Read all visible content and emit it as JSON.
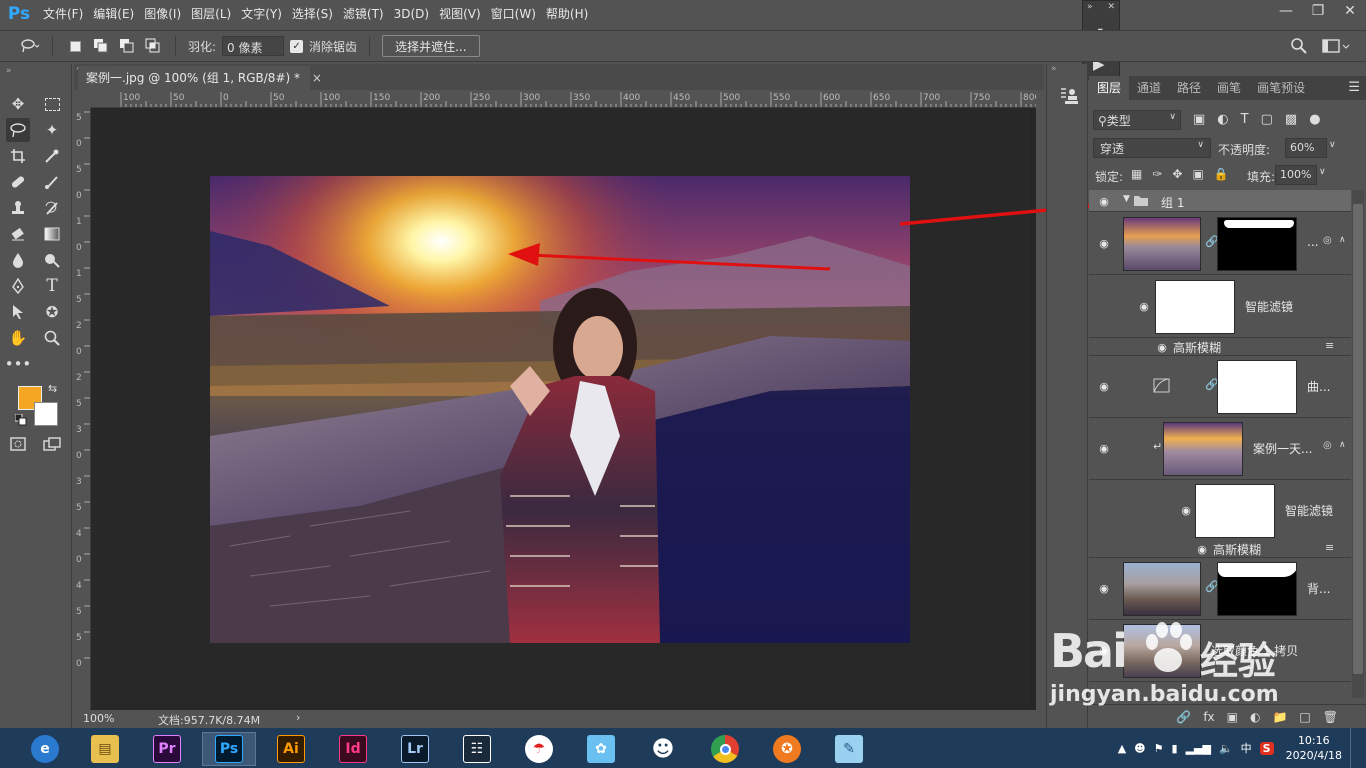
{
  "app": {
    "logo": "Ps",
    "menus": [
      "文件(F)",
      "编辑(E)",
      "图像(I)",
      "图层(L)",
      "文字(Y)",
      "选择(S)",
      "滤镜(T)",
      "3D(D)",
      "视图(V)",
      "窗口(W)",
      "帮助(H)"
    ],
    "window_controls": [
      "minimize-icon",
      "restore-icon",
      "close-icon"
    ]
  },
  "options": {
    "feather_label": "羽化:",
    "feather_value": "0 像素",
    "antialias_label": "消除锯齿",
    "antialias_checked": true,
    "select_mask_button": "选择并遮住...",
    "right_icons": [
      "search-icon",
      "workspace-icon"
    ]
  },
  "document": {
    "tab_title": "案例一.jpg @ 100% (组 1, RGB/8#) *",
    "tab_close": "×",
    "hruler_ticks": [
      "100",
      "50",
      "0",
      "50",
      "100",
      "150",
      "200",
      "250",
      "300",
      "350",
      "400",
      "450",
      "500",
      "550",
      "600",
      "650",
      "700",
      "750",
      "800"
    ],
    "vruler_ticks": [
      "5",
      "0",
      "5",
      "0",
      "1",
      "0",
      "1",
      "5",
      "2",
      "0",
      "2",
      "5",
      "3",
      "0",
      "3",
      "5",
      "4",
      "0",
      "4",
      "5",
      "5",
      "0"
    ],
    "zoom": "100%",
    "doc_info": "文档:957.7K/8.74M",
    "status_arrow": "›"
  },
  "colors": {
    "foreground": "#f5a623",
    "background": "#ffffff",
    "accent_ps": "#31a8ff",
    "arrow_red": "#e01010"
  },
  "layers_panel": {
    "tabs": [
      "图层",
      "通道",
      "路径",
      "画笔",
      "画笔预设"
    ],
    "filter_kind": "类型",
    "blend_mode": "穿透",
    "opacity_label": "不透明度:",
    "opacity_value": "60%",
    "lock_label": "锁定:",
    "fill_label": "填充:",
    "fill_value": "100%",
    "group_name": "组 1",
    "layer1_name": "...",
    "smart_filter_1": "智能滤镜",
    "gaussian_1": "高斯模糊",
    "curves_name": "曲...",
    "layer2_name": "案例一天...",
    "smart_filter_2": "智能滤镜",
    "gaussian_2": "高斯模糊",
    "bg_name": "背...",
    "copy_name": "选取颜色 1 拷贝"
  },
  "taskbar": {
    "apps": [
      "browser",
      "explorer",
      "Pr",
      "Ps",
      "Ai",
      "Id",
      "Lr",
      "video",
      "app-umbrella",
      "app-bird",
      "qq",
      "chrome",
      "app-fox",
      "notes"
    ],
    "time": "10:16",
    "date": "2020/4/18",
    "ime": "中"
  },
  "watermark": {
    "brand": "Bai",
    "brand2": "经验",
    "url": "jingyan.baidu.com"
  }
}
